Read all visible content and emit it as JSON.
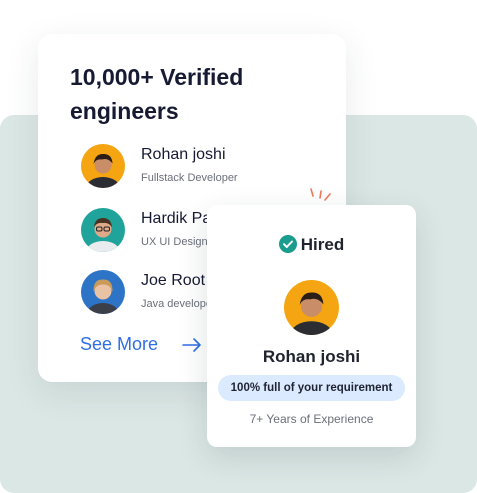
{
  "engineers_card": {
    "title": "10,000+ Verified engineers",
    "engineers": [
      {
        "name": "Rohan joshi",
        "role": "Fullstack Developer",
        "avatar_icon": "avatar-orange-icon",
        "avatar_color": "#f4a511"
      },
      {
        "name": "Hardik Pa",
        "role": "UX UI Design",
        "avatar_icon": "avatar-teal-icon",
        "avatar_color": "#1fa39a"
      },
      {
        "name": "Joe Root",
        "role": "Java develope",
        "avatar_icon": "avatar-blue-icon",
        "avatar_color": "#2d74c6"
      }
    ],
    "see_more_label": "See More",
    "see_more_icon": "arrow-right-icon",
    "accent_color": "#2f6fe4"
  },
  "hired_card": {
    "status_icon": "check-circle-icon",
    "status_label": "Hired",
    "status_color": "#1a9c8e",
    "name": "Rohan joshi",
    "badge": "100% full of your requirement",
    "badge_color": "#dbeaff",
    "experience": "7+ Years of Experience"
  },
  "background_color": "#dbe7e5",
  "sparkle_color": "#f0785a"
}
